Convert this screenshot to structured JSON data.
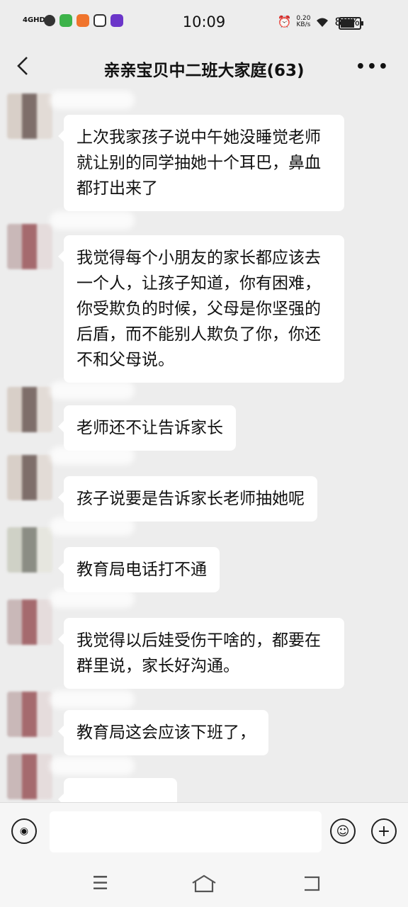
{
  "status_bar": {
    "network": "4GHD",
    "time": "10:09",
    "net_speed": "0.20",
    "net_speed_unit": "KB/s",
    "battery_text": "80%",
    "battery_level": 0.8
  },
  "header": {
    "title": "亲亲宝贝中二班大家庭(63)",
    "back_icon": "chevron-left-icon",
    "more_icon": "more-dots-icon"
  },
  "messages": [
    {
      "text": "上次我家孩子说中午她没睡觉老师就让别的同学抽她十个耳巴，鼻血都打出来了"
    },
    {
      "text": "我觉得每个小朋友的家长都应该去一个人，让孩子知道，你有困难，你受欺负的时候，父母是你坚强的后盾，而不能别人欺负了你，你还不和父母说。"
    },
    {
      "text": "老师还不让告诉家长"
    },
    {
      "text": "孩子说要是告诉家长老师抽她呢"
    },
    {
      "text": "教育局电话打不通"
    },
    {
      "text": "我觉得以后娃受伤干啥的，都要在群里说，家长好沟通。"
    },
    {
      "text": "教育局这会应该下班了，"
    }
  ],
  "input_bar": {
    "voice_icon": "voice-icon",
    "emoji_icon": "emoji-icon",
    "add_icon": "plus-icon",
    "text_value": ""
  },
  "nav_bar": {
    "menu_icon": "menu-icon",
    "home_icon": "home-icon",
    "back_icon": "back-arrow-icon"
  }
}
